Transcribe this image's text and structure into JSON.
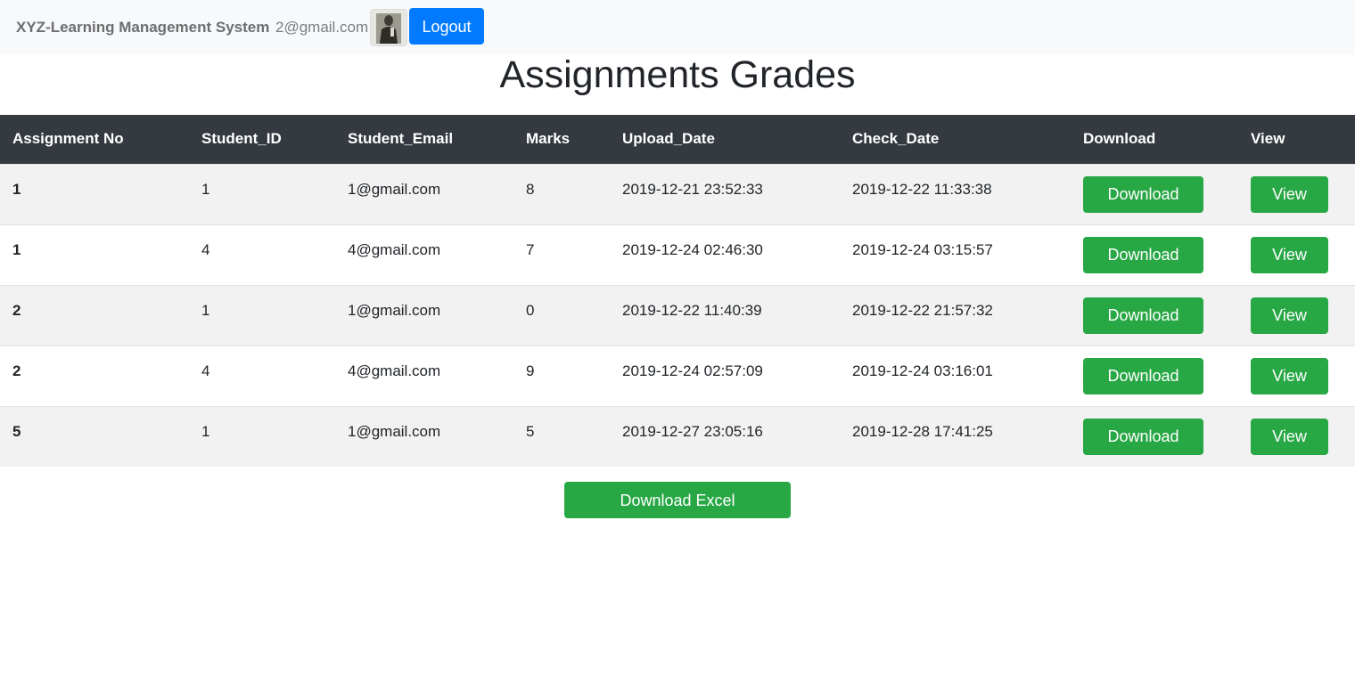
{
  "navbar": {
    "brand": "XYZ-Learning Management System",
    "user_email": "2@gmail.com",
    "avatar_icon": "user-photo",
    "logout_label": "Logout"
  },
  "page": {
    "title": "Assignments Grades"
  },
  "table": {
    "headers": [
      "Assignment No",
      "Student_ID",
      "Student_Email",
      "Marks",
      "Upload_Date",
      "Check_Date",
      "Download",
      "View"
    ],
    "rows": [
      {
        "assignment_no": "1",
        "student_id": "1",
        "student_email": "1@gmail.com",
        "marks": "8",
        "upload_date": "2019-12-21 23:52:33",
        "check_date": "2019-12-22 11:33:38",
        "download_label": "Download",
        "view_label": "View"
      },
      {
        "assignment_no": "1",
        "student_id": "4",
        "student_email": "4@gmail.com",
        "marks": "7",
        "upload_date": "2019-12-24 02:46:30",
        "check_date": "2019-12-24 03:15:57",
        "download_label": "Download",
        "view_label": "View"
      },
      {
        "assignment_no": "2",
        "student_id": "1",
        "student_email": "1@gmail.com",
        "marks": "0",
        "upload_date": "2019-12-22 11:40:39",
        "check_date": "2019-12-22 21:57:32",
        "download_label": "Download",
        "view_label": "View"
      },
      {
        "assignment_no": "2",
        "student_id": "4",
        "student_email": "4@gmail.com",
        "marks": "9",
        "upload_date": "2019-12-24 02:57:09",
        "check_date": "2019-12-24 03:16:01",
        "download_label": "Download",
        "view_label": "View"
      },
      {
        "assignment_no": "5",
        "student_id": "1",
        "student_email": "1@gmail.com",
        "marks": "5",
        "upload_date": "2019-12-27 23:05:16",
        "check_date": "2019-12-28 17:41:25",
        "download_label": "Download",
        "view_label": "View"
      }
    ]
  },
  "footer": {
    "download_excel_label": "Download Excel"
  },
  "colors": {
    "navbar_bg": "#f8f9fa",
    "table_header_bg": "#343a40",
    "striped_row_bg": "#f2f2f2",
    "primary_button": "#007bff",
    "success_button": "#28a745"
  }
}
